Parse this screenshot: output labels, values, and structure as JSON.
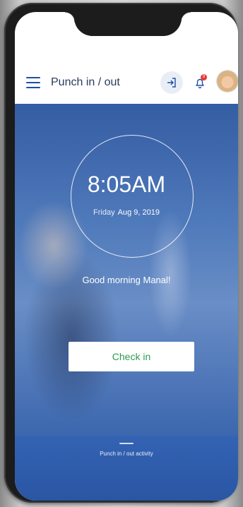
{
  "header": {
    "title": "Punch in / out",
    "notification_count": "9"
  },
  "clock": {
    "time": "8:05AM",
    "day": "Friday",
    "date": "Aug 9, 2019"
  },
  "greeting": {
    "text": "Good morning",
    "name": "Manal!"
  },
  "actions": {
    "check_in_label": "Check in"
  },
  "footer": {
    "activity_label": "Punch in / out activity"
  },
  "colors": {
    "accent": "#1f4ea6",
    "success": "#2c9c4f",
    "alert": "#e53935",
    "hero": "#4e79ba"
  },
  "icons": [
    "menu-icon",
    "exit-icon",
    "bell-icon"
  ]
}
